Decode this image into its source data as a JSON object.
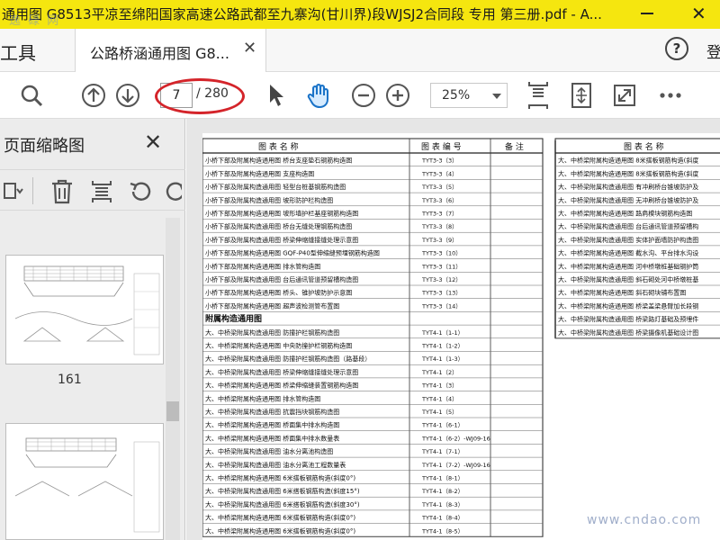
{
  "window": {
    "title": "通用图 G8513平凉至绵阳国家高速公路武都至九寨沟(甘川界)段WJSJ2合同段 专用 第三册.pdf - A...",
    "watermark": "逸 碌 网"
  },
  "tabs": {
    "tools_label": "工具",
    "doc_tab_label": "公路桥涵通用图 G8...",
    "login_label": "登"
  },
  "toolbar": {
    "page_current": "7",
    "page_total": "/ 280",
    "zoom_value": "25%"
  },
  "thumbnails": {
    "panel_title": "页面缩略图",
    "items": [
      {
        "label": "161"
      },
      {
        "label": ""
      }
    ]
  },
  "document": {
    "headers": [
      "图   表   名   称",
      "图   表   编   号",
      "备   注"
    ],
    "rows": [
      {
        "name": "小桥下部及附属构造通用图  桥台支座垫石钢筋构造图",
        "code": "TYT3-3（3）"
      },
      {
        "name": "小桥下部及附属构造通用图  支座构造图",
        "code": "TYT3-3（4）"
      },
      {
        "name": "小桥下部及附属构造通用图  轻型台桩基钢筋构造图",
        "code": "TYT3-3（5）"
      },
      {
        "name": "小桥下部及附属构造通用图  坡形防护栏构造图",
        "code": "TYT3-3（6）"
      },
      {
        "name": "小桥下部及附属构造通用图  坡形墙护栏基座钢筋构造图",
        "code": "TYT3-3（7）"
      },
      {
        "name": "小桥下部及附属构造通用图  桥台无缝处理钢筋构造图",
        "code": "TYT3-3（8）"
      },
      {
        "name": "小桥下部及附属构造通用图  桥梁伸缩缝接缝处理示意图",
        "code": "TYT3-3（9）"
      },
      {
        "name": "小桥下部及附属构造通用图  GQF-P40型伸缩缝预埋钢筋构造图",
        "code": "TYT3-3（10）"
      },
      {
        "name": "小桥下部及附属构造通用图  排水管构造图",
        "code": "TYT3-3（11）"
      },
      {
        "name": "小桥下部及附属构造通用图  台后通讯管道预留槽构造图",
        "code": "TYT3-3（12）"
      },
      {
        "name": "小桥下部及附属构造通用图  桥头、锥护坡防护示意图",
        "code": "TYT3-3（13）"
      },
      {
        "name": "小桥下部及附属构造通用图  超声波检测管布置图",
        "code": "TYT3-3（14）"
      },
      {
        "name": "附属构造通用图",
        "code": "",
        "section": true
      },
      {
        "name": "大、中桥梁附属构造通用图  防撞护栏钢筋构造图",
        "code": "TYT4-1（1-1）"
      },
      {
        "name": "大、中桥梁附属构造通用图  中央防撞护栏钢筋构造图",
        "code": "TYT4-1（1-2）"
      },
      {
        "name": "大、中桥梁附属构造通用图  防撞护栏钢筋构造图（路基段）",
        "code": "TYT4-1（1-3）"
      },
      {
        "name": "大、中桥梁附属构造通用图  桥梁伸缩缝接缝处理示意图",
        "code": "TYT4-1（2）"
      },
      {
        "name": "大、中桥梁附属构造通用图  桥梁伸缩缝装置钢筋构造图",
        "code": "TYT4-1（3）"
      },
      {
        "name": "大、中桥梁附属构造通用图  排水管构造图",
        "code": "TYT4-1（4）"
      },
      {
        "name": "大、中桥梁附属构造通用图  抗震挡块钢筋构造图",
        "code": "TYT4-1（5）"
      },
      {
        "name": "大、中桥梁附属构造通用图  桥面集中排水构造图",
        "code": "TYT4-1（6-1）"
      },
      {
        "name": "大、中桥梁附属构造通用图  桥面集中排水数量表",
        "code": "TYT4-1（6-2）-WJ09-16"
      },
      {
        "name": "大、中桥梁附属构造通用图  油水分离池构造图",
        "code": "TYT4-1（7-1）"
      },
      {
        "name": "大、中桥梁附属构造通用图  油水分离池工程数量表",
        "code": "TYT4-1（7-2）-WJ09-16"
      },
      {
        "name": "大、中桥梁附属构造通用图  6米搭板钢筋构造(斜度0°)",
        "code": "TYT4-1（8-1）"
      },
      {
        "name": "大、中桥梁附属构造通用图  6米搭板钢筋构造(斜度15°)",
        "code": "TYT4-1（8-2）"
      },
      {
        "name": "大、中桥梁附属构造通用图  6米搭板钢筋构造(斜度30°)",
        "code": "TYT4-1（8-3）"
      },
      {
        "name": "大、中桥梁附属构造通用图  6米搭板钢筋构造(斜度0°)",
        "code": "TYT4-1（8-4）"
      },
      {
        "name": "大、中桥梁附属构造通用图  6米搭板钢筋构造(斜度0°)",
        "code": "TYT4-1（8-5）"
      }
    ],
    "right_header": "图   表   名   称",
    "right_rows": [
      "大、中桥梁附属构造通用图  8米搭板钢筋构造(斜度",
      "大、中桥梁附属构造通用图  8米搭板钢筋构造(斜度",
      "大、中桥梁附属构造通用图  有冲刷桥台锥坡防护及",
      "大、中桥梁附属构造通用图  无冲刷桥台锥坡防护及",
      "大、中桥梁附属构造通用图  路肩模块钢筋构造图",
      "大、中桥梁附属构造通用图  台后通讯管道预留槽构",
      "大、中桥梁附属构造通用图  实体护面墙防护构造图",
      "大、中桥梁附属构造通用图  截水沟、平台排水沟设",
      "大、中桥梁附属构造通用图  河中桥墩桩基础钢护筒",
      "大、中桥梁附属构造通用图  斜石砌处河中桥墩桩基",
      "大、中桥梁附属构造通用图  斜石砌块铺布置图",
      "大、中桥梁附属构造通用图  桥梁盖梁悬臂加长段钢",
      "大、中桥梁附属构造通用图  桥梁路灯基础及预埋件",
      "大、中桥梁附属构造通用图  桥梁摄像机基础设计图"
    ],
    "watermark": "www.cndao.com"
  }
}
